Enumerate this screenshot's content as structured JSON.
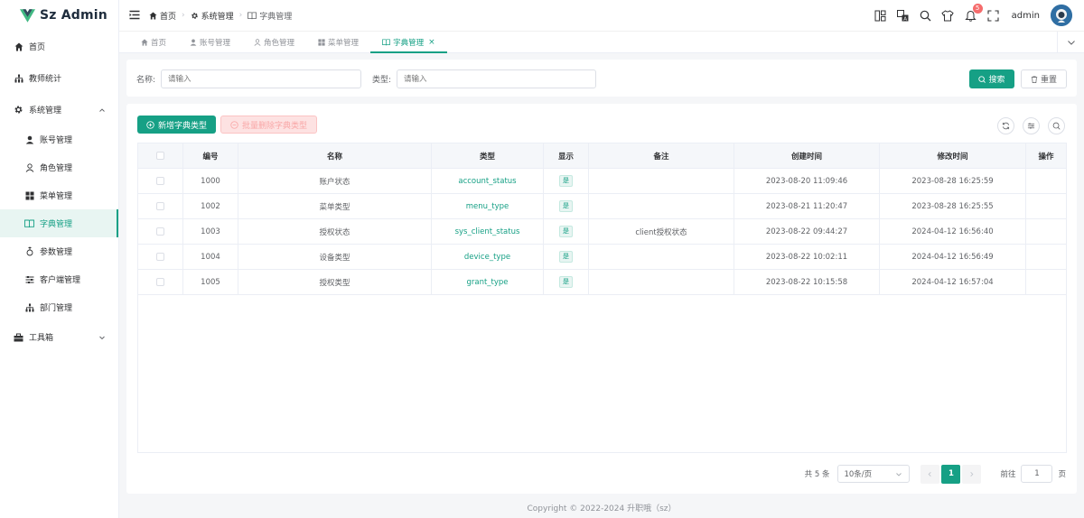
{
  "app": {
    "title": "Sz Admin"
  },
  "sidebar": {
    "items": [
      {
        "label": "首页",
        "icon": "home-icon"
      },
      {
        "label": "教师统计",
        "icon": "chart-icon"
      },
      {
        "label": "系统管理",
        "icon": "gear-icon",
        "expanded": true
      },
      {
        "label": "账号管理",
        "icon": "user-icon"
      },
      {
        "label": "角色管理",
        "icon": "user-outline-icon"
      },
      {
        "label": "菜单管理",
        "icon": "grid-icon"
      },
      {
        "label": "字典管理",
        "icon": "book-icon",
        "active": true
      },
      {
        "label": "参数管理",
        "icon": "param-icon"
      },
      {
        "label": "客户端管理",
        "icon": "sliders-icon"
      },
      {
        "label": "部门管理",
        "icon": "org-icon"
      },
      {
        "label": "工具箱",
        "icon": "toolbox-icon"
      }
    ]
  },
  "header": {
    "breadcrumb": [
      "首页",
      "系统管理",
      "字典管理"
    ],
    "badge_count": "5",
    "user_name": "admin"
  },
  "tabs": [
    {
      "label": "首页"
    },
    {
      "label": "账号管理"
    },
    {
      "label": "角色管理"
    },
    {
      "label": "菜单管理"
    },
    {
      "label": "字典管理",
      "active": true,
      "close": "×"
    }
  ],
  "search": {
    "name_label": "名称:",
    "name_placeholder": "请输入",
    "type_label": "类型:",
    "type_placeholder": "请输入",
    "search_button": "搜索",
    "reset_button": "重置"
  },
  "toolbar": {
    "add_button": "新增字典类型",
    "batch_delete_button": "批量删除字典类型"
  },
  "table": {
    "columns": [
      "编号",
      "名称",
      "类型",
      "显示",
      "备注",
      "创建时间",
      "修改时间",
      "操作"
    ],
    "rows": [
      {
        "id": "1000",
        "name": "账户状态",
        "type": "account_status",
        "show": "是",
        "note": "",
        "created": "2023-08-20 11:09:46",
        "modified": "2023-08-28 16:25:59"
      },
      {
        "id": "1002",
        "name": "菜单类型",
        "type": "menu_type",
        "show": "是",
        "note": "",
        "created": "2023-08-21 11:20:47",
        "modified": "2023-08-28 16:25:55"
      },
      {
        "id": "1003",
        "name": "授权状态",
        "type": "sys_client_status",
        "show": "是",
        "note": "client授权状态",
        "created": "2023-08-22 09:44:27",
        "modified": "2024-04-12 16:56:40"
      },
      {
        "id": "1004",
        "name": "设备类型",
        "type": "device_type",
        "show": "是",
        "note": "",
        "created": "2023-08-22 10:02:11",
        "modified": "2024-04-12 16:56:49"
      },
      {
        "id": "1005",
        "name": "授权类型",
        "type": "grant_type",
        "show": "是",
        "note": "",
        "created": "2023-08-22 10:15:58",
        "modified": "2024-04-12 16:57:04"
      }
    ]
  },
  "pagination": {
    "total": "共 5 条",
    "page_size": "10条/页",
    "current_page": "1",
    "goto_label": "前往",
    "goto_value": "1",
    "page_suffix": "页"
  },
  "footer": {
    "copyright": "Copyright © 2022-2024 升职哦（sz）"
  },
  "colors": {
    "primary": "#16a085",
    "danger_light": "#fde2e2",
    "badge": "#f56c6c"
  }
}
